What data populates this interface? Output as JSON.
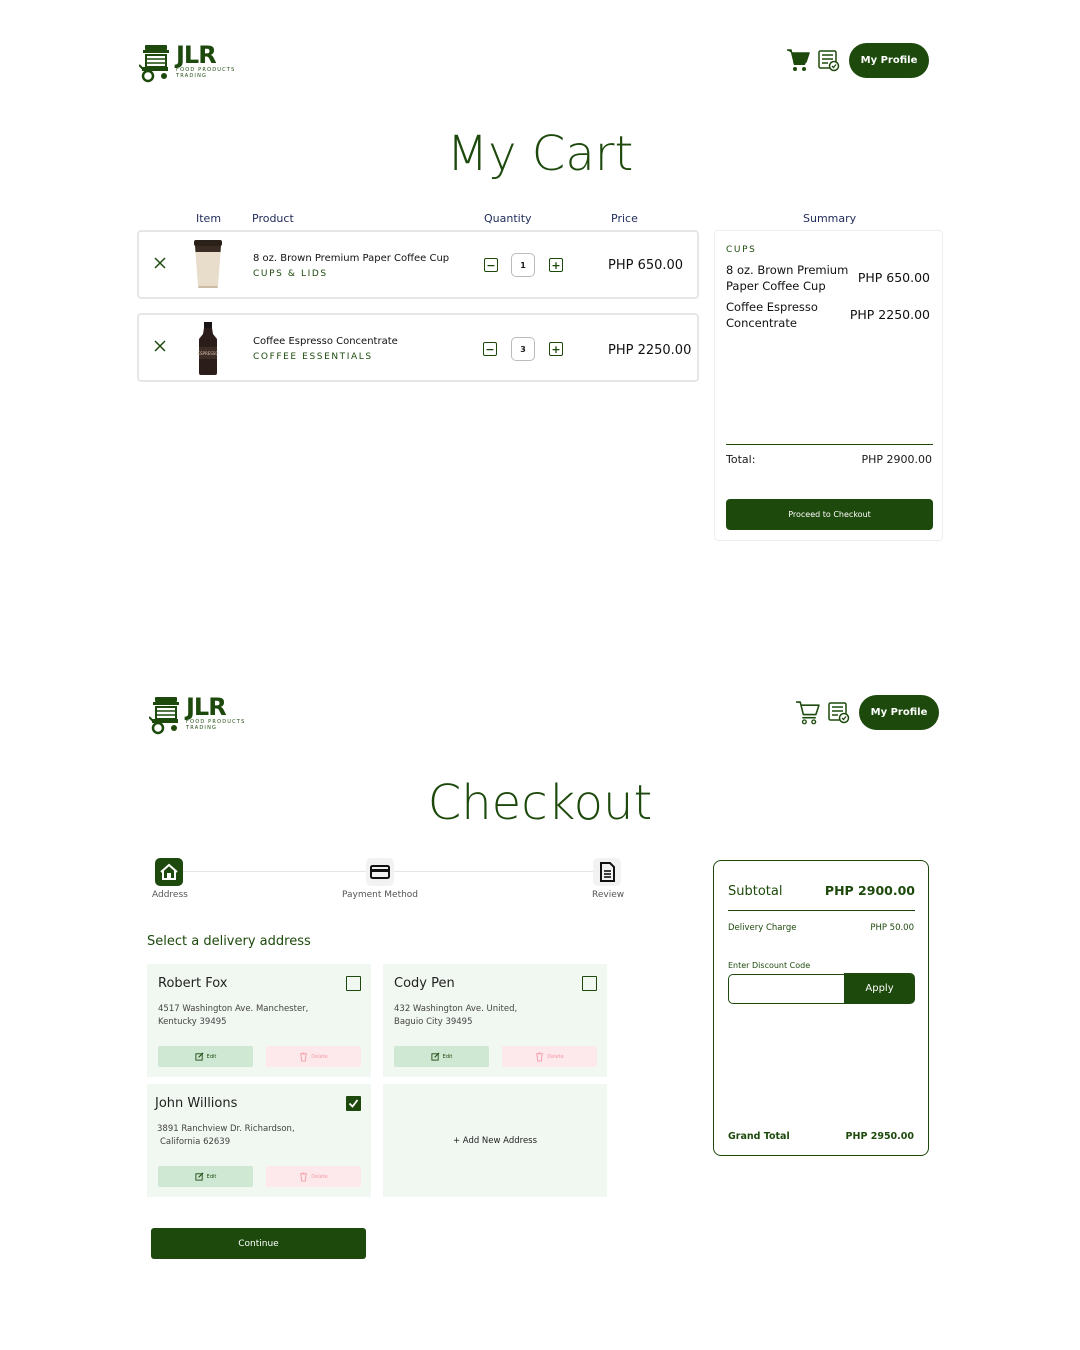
{
  "brand": {
    "letters": "JLR",
    "subtitle_line1": "FOOD PRODUCTS",
    "subtitle_line2": "TRADING",
    "color": "#1d4a0c"
  },
  "header": {
    "profile_label": "My Profile",
    "icons": [
      "cart-icon",
      "order-history-icon"
    ]
  },
  "cart": {
    "title": "My Cart",
    "columns": {
      "item": "Item",
      "product": "Product",
      "quantity": "Quantity",
      "price": "Price",
      "summary": "Summary"
    },
    "items": [
      {
        "name": "8 oz. Brown Premium Paper Coffee Cup",
        "category": "CUPS & LIDS",
        "quantity": "1",
        "price": "PHP 650.00"
      },
      {
        "name": "Coffee Espresso Concentrate",
        "category": "COFFEE ESSENTIALS",
        "quantity": "3",
        "price": "PHP 2250.00"
      }
    ],
    "summary": {
      "category": "CUPS",
      "lines": [
        {
          "name": "8 oz. Brown Premium Paper Coffee Cup",
          "price": "PHP 650.00"
        },
        {
          "name": "Coffee Espresso Concentrate",
          "price": "PHP 2250.00"
        }
      ],
      "total_label": "Total:",
      "total_value": "PHP 2900.00",
      "checkout_label": "Proceed to Checkout"
    }
  },
  "checkout": {
    "title": "Checkout",
    "steps": [
      {
        "label": "Address",
        "icon": "home-icon",
        "active": true
      },
      {
        "label": "Payment Method",
        "icon": "credit-card-icon",
        "active": false
      },
      {
        "label": "Review",
        "icon": "document-icon",
        "active": false
      }
    ],
    "section_label": "Select a delivery address",
    "addresses": [
      {
        "name": "Robert Fox",
        "line1": "4517 Washington Ave. Manchester,",
        "line2": "Kentucky 39495",
        "selected": false
      },
      {
        "name": "Cody Pen",
        "line1": "432 Washington Ave. United,",
        "line2": "Baguio City 39495",
        "selected": false
      },
      {
        "name": "John Willions",
        "line1": "3891 Ranchview Dr. Richardson,",
        "line2": "California 62639",
        "selected": true
      }
    ],
    "edit_label": "Edit",
    "delete_label": "Delete",
    "add_address_label": "+ Add New Address",
    "continue_label": "Continue",
    "order": {
      "subtotal_label": "Subtotal",
      "subtotal_value": "PHP 2900.00",
      "delivery_label": "Delivery Charge",
      "delivery_value": "PHP 50.00",
      "discount_label": "Enter Discount Code",
      "discount_value": "",
      "apply_label": "Apply",
      "grand_total_label": "Grand Total",
      "grand_total_value": "PHP 2950.00"
    }
  }
}
